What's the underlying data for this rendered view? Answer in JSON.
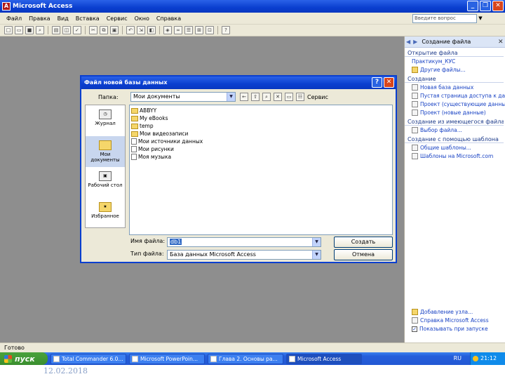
{
  "window": {
    "title": "Microsoft Access",
    "app_icon": "access-key-icon"
  },
  "menu": [
    "Файл",
    "Правка",
    "Вид",
    "Вставка",
    "Сервис",
    "Окно",
    "Справка"
  ],
  "help_box": {
    "placeholder": "Введите вопрос"
  },
  "task_pane": {
    "title": "Создание файла",
    "open_section": "Открытие файла",
    "open_links": [
      "Практикум_КУС",
      "Другие файлы..."
    ],
    "create_section": "Создание",
    "create_links": [
      "Новая база данных",
      "Пустая страница доступа к данным",
      "Проект (существующие данные)",
      "Проект (новые данные)"
    ],
    "existing_section": "Создание из имеющегося файла",
    "existing_links": [
      "Выбор файла..."
    ],
    "template_section": "Создание с помощью шаблона",
    "template_links": [
      "Общие шаблоны...",
      "Шаблоны на Microsoft.com"
    ],
    "bottom_links": [
      "Добавление узла...",
      "Справка Microsoft Access"
    ],
    "startup_check": "Показывать при запуске"
  },
  "dialog": {
    "title": "Файл новой базы данных",
    "folder_label": "Папка:",
    "folder_value": "Мои документы",
    "service_label": "Сервис",
    "places": [
      "Журнал",
      "Мои документы",
      "Рабочий стол",
      "Избранное"
    ],
    "files": [
      "ABBYY",
      "My eBooks",
      "temp",
      "Мои видеозаписи",
      "Мои источники данных",
      "Мои рисунки",
      "Моя музыка"
    ],
    "filename_label": "Имя файла:",
    "filename_value": "db1",
    "filetype_label": "Тип файла:",
    "filetype_value": "База данных Microsoft Access",
    "create_button": "Создать",
    "cancel_button": "Отмена"
  },
  "status_bar": {
    "text": "Готово"
  },
  "taskbar": {
    "start_label": "пуск",
    "tasks": [
      "Total Commander 6.0...",
      "Microsoft PowerPoin...",
      "Глава 2. Основы ра...",
      "Microsoft Access"
    ],
    "language": "RU",
    "clock": "21:12"
  },
  "slide_date": "12.02.2018"
}
